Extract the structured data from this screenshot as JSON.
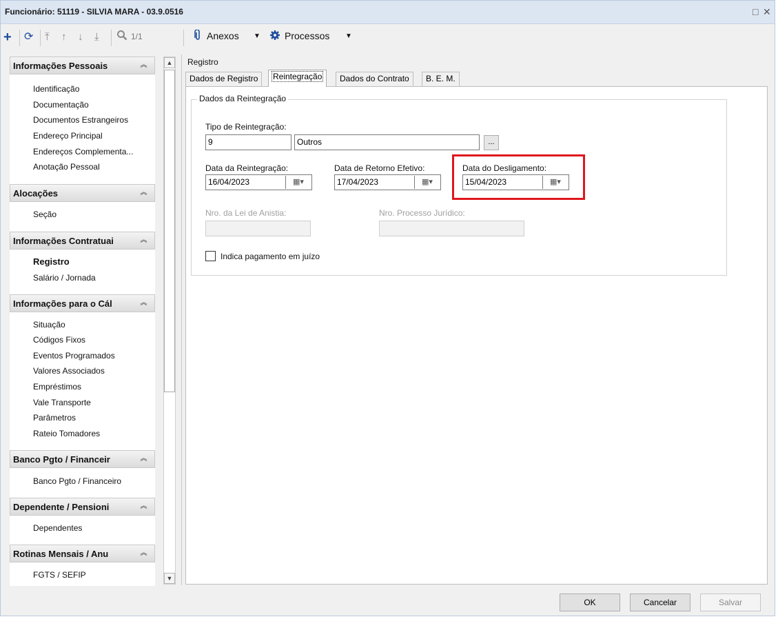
{
  "window": {
    "title": "Funcionário: 51119 - SILVIA MARA - 03.9.0516",
    "restore_glyph": "□",
    "close_glyph": "✕"
  },
  "toolbar": {
    "record_count": "1/1",
    "attachments_label": "Anexos",
    "processes_label": "Processos"
  },
  "sidebar": {
    "groups": [
      {
        "title": "Informações Pessoais",
        "items": [
          "Identificação",
          "Documentação",
          "Documentos Estrangeiros",
          "Endereço Principal",
          "Endereços Complementa...",
          "Anotação Pessoal"
        ]
      },
      {
        "title": "Alocações",
        "items": [
          "Seção"
        ]
      },
      {
        "title": "Informações Contratuai",
        "items": [
          "Registro",
          "Salário / Jornada"
        ]
      },
      {
        "title": "Informações para o Cál",
        "items": [
          "Situação",
          "Códigos Fixos",
          "Eventos Programados",
          "Valores Associados",
          "Empréstimos",
          "Vale Transporte",
          "Parâmetros",
          "Rateio Tomadores"
        ]
      },
      {
        "title": "Banco Pgto / Financeir",
        "items": [
          "Banco Pgto / Financeiro"
        ]
      },
      {
        "title": "Dependente / Pensioni",
        "items": [
          "Dependentes"
        ]
      },
      {
        "title": "Rotinas Mensais / Anu",
        "items": [
          "FGTS / SEFIP"
        ]
      }
    ],
    "active_item": "Registro"
  },
  "main": {
    "section_label": "Registro",
    "tabs": [
      "Dados de Registro",
      "Reintegração",
      "Dados do Contrato",
      "B. E. M."
    ],
    "active_tab": "Reintegração",
    "fieldset_legend": "Dados da Reintegração",
    "tipo_reintegracao": {
      "label": "Tipo de Reintegração:",
      "code": "9",
      "description": "Outros",
      "lookup_button": "..."
    },
    "data_reintegracao": {
      "label": "Data da Reintegração:",
      "value": "16/04/2023"
    },
    "data_retorno": {
      "label": "Data de Retorno Efetivo:",
      "value": "17/04/2023"
    },
    "data_desligamento": {
      "label": "Data do Desligamento:",
      "value": "15/04/2023"
    },
    "lei_anistia": {
      "label": "Nro. da Lei de Anistia:",
      "value": ""
    },
    "processo_juridico": {
      "label": "Nro. Processo Jurídico:",
      "value": ""
    },
    "pagamento_juizo": {
      "label": "Indica pagamento em juízo",
      "checked": false
    }
  },
  "footer": {
    "ok_label": "OK",
    "cancel_label": "Cancelar",
    "save_label": "Salvar"
  },
  "colors": {
    "highlight": "#e0161d",
    "toolbar_icon": "#1f4e9c"
  }
}
